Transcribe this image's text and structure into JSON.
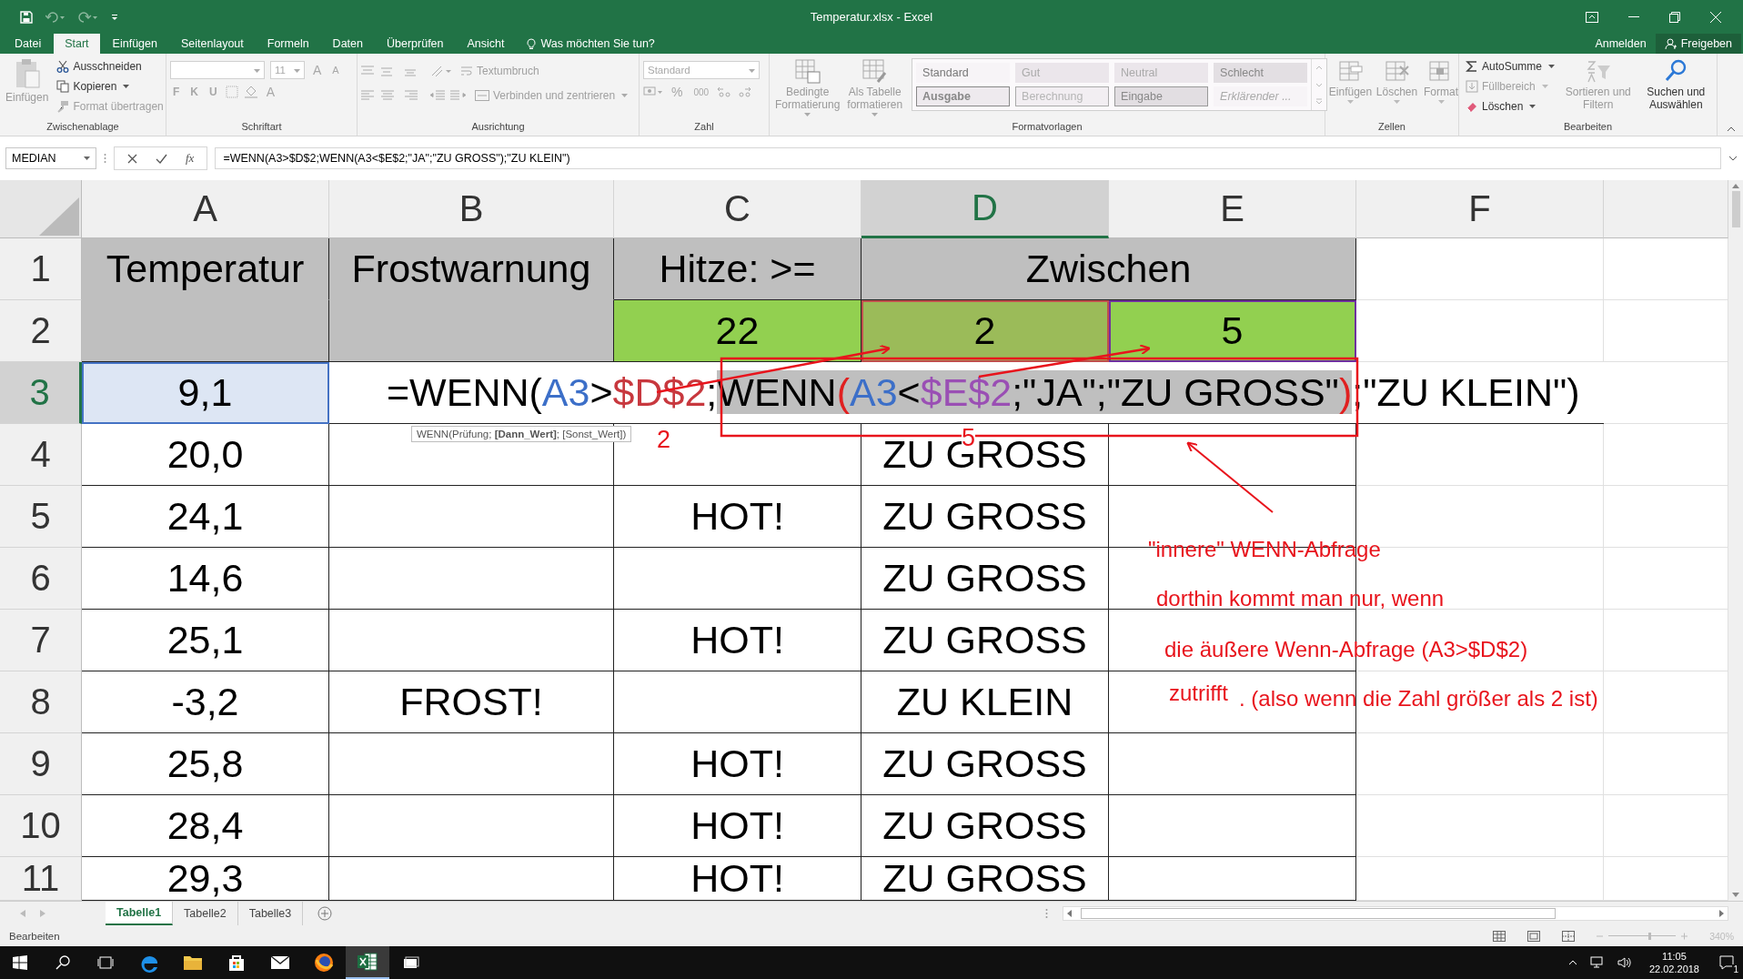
{
  "window": {
    "title": "Temperatur.xlsx - Excel"
  },
  "tabs": [
    {
      "label": "Datei",
      "selected": false
    },
    {
      "label": "Start",
      "selected": true
    },
    {
      "label": "Einfügen",
      "selected": false
    },
    {
      "label": "Seitenlayout",
      "selected": false
    },
    {
      "label": "Formeln",
      "selected": false
    },
    {
      "label": "Daten",
      "selected": false
    },
    {
      "label": "Überprüfen",
      "selected": false
    },
    {
      "label": "Ansicht",
      "selected": false
    }
  ],
  "tell_me": "Was möchten Sie tun?",
  "account": {
    "sign_in": "Anmelden",
    "share": "Freigeben"
  },
  "ribbon": {
    "clipboard": {
      "label": "Zwischenablage",
      "paste": {
        "label": "Einfügen",
        "disabled": true
      },
      "items": [
        {
          "label": "Ausschneiden",
          "disabled": false
        },
        {
          "label": "Kopieren",
          "disabled": false
        },
        {
          "label": "Format übertragen",
          "disabled": true
        }
      ]
    },
    "font": {
      "label": "Schriftart",
      "size": "11",
      "grow": "A",
      "shrink": "A",
      "styles": [
        "F",
        "K",
        "U"
      ],
      "font_color": "A"
    },
    "alignment": {
      "label": "Ausrichtung",
      "wrap": "Textumbruch",
      "merge": "Verbinden und zentrieren"
    },
    "number": {
      "label": "Zahl",
      "format": "Standard",
      "percent": "%",
      "thousands": "000"
    },
    "format_buttons": [
      {
        "label": "Bedingte Formatierung"
      },
      {
        "label": "Als Tabelle formatieren"
      }
    ],
    "styles": {
      "label": "Formatvorlagen",
      "cells": [
        {
          "label": "Standard",
          "kind": "normal"
        },
        {
          "label": "Gut",
          "kind": "good"
        },
        {
          "label": "Neutral",
          "kind": "neutral"
        },
        {
          "label": "Schlecht",
          "kind": "bad"
        },
        {
          "label": "Ausgabe",
          "kind": "output"
        },
        {
          "label": "Berechnung",
          "kind": "calc"
        },
        {
          "label": "Eingabe",
          "kind": "input"
        },
        {
          "label": "Erklärender ...",
          "kind": "explanatory"
        }
      ]
    },
    "cells": {
      "label": "Zellen",
      "items": [
        "Einfügen",
        "Löschen",
        "Format"
      ]
    },
    "editing": {
      "label": "Bearbeiten",
      "items": [
        {
          "label": "AutoSumme",
          "disabled": false
        },
        {
          "label": "Füllbereich",
          "disabled": true
        },
        {
          "label": "Löschen",
          "disabled": false
        }
      ],
      "sort": {
        "label": "Sortieren und Filtern",
        "disabled": true
      },
      "find": {
        "label": "Suchen und Auswählen",
        "disabled": false
      }
    }
  },
  "formula_bar": {
    "name_box": "MEDIAN",
    "fx": "fx",
    "formula": "=WENN(A3>$D$2;WENN(A3<$E$2;\"JA\";\"ZU GROSS\");\"ZU KLEIN\")"
  },
  "sheet": {
    "columns": [
      {
        "label": "A",
        "selected": false
      },
      {
        "label": "B",
        "selected": false
      },
      {
        "label": "C",
        "selected": false
      },
      {
        "label": "D",
        "selected": true
      },
      {
        "label": "E",
        "selected": false
      },
      {
        "label": "F",
        "selected": false
      }
    ],
    "rows": [
      {
        "header": "1",
        "selected": false,
        "cells": [
          {
            "text": "Temperatur",
            "color": "#bfbfbf"
          },
          {
            "text": "Frostwarnung",
            "color": "#bfbfbf"
          },
          {
            "text": "Hitze: >=",
            "color": "#bfbfbf"
          },
          {
            "text": "Zwischen",
            "color": "#bfbfbf",
            "merged": true
          }
        ]
      },
      {
        "header": "2",
        "selected": false,
        "cells": [
          {
            "color": "#bfbfbf"
          },
          {
            "color": "#bfbfbf"
          },
          {
            "text": "22",
            "color": "#92d050"
          },
          {
            "text": "2",
            "color": "#9bbb59",
            "outline": {
              "color": "#c0504d"
            }
          },
          {
            "text": "5",
            "color": "#92d050",
            "outline": {
              "color": "#7030a0"
            }
          }
        ]
      },
      {
        "header": "3",
        "selected": true,
        "kind": "editing",
        "cells": [
          {
            "text": "9,1",
            "color": "#dde6f4",
            "outline": {
              "color": "#4472c4"
            }
          }
        ],
        "editor": {
          "segments": [
            {
              "text": "=WENN(",
              "color": "#000000",
              "highlighted": false
            },
            {
              "text": "A3",
              "color": "#3c6fc8",
              "highlighted": false
            },
            {
              "text": ">",
              "color": "#000000",
              "highlighted": false
            },
            {
              "text": "$D$2",
              "color": "#c8383e",
              "highlighted": false
            },
            {
              "text": ";",
              "color": "#000000",
              "highlighted": false
            },
            {
              "text": "WENN",
              "color": "#000000",
              "highlighted": true
            },
            {
              "text": "(",
              "color": "#e02020",
              "highlighted": true
            },
            {
              "text": "A3",
              "color": "#3c6fc8",
              "highlighted": true
            },
            {
              "text": "<",
              "color": "#000000",
              "highlighted": true
            },
            {
              "text": "$E$2",
              "color": "#9a4fb4",
              "highlighted": true
            },
            {
              "text": ";\"JA\";\"ZU GROSS\"",
              "color": "#000000",
              "highlighted": true
            },
            {
              "text": ")",
              "color": "#e02020",
              "highlighted": true
            },
            {
              "text": ";\"ZU KLEIN\")",
              "color": "#000000",
              "highlighted": false
            }
          ],
          "tooltip": "WENN(Prüfung; **[Dann_Wert]**; [Sonst_Wert])"
        }
      },
      {
        "header": "4",
        "selected": false,
        "cells": [
          {
            "text": "20,0"
          },
          {},
          {},
          {
            "text": "ZU GROSS"
          }
        ]
      },
      {
        "header": "5",
        "selected": false,
        "cells": [
          {
            "text": "24,1"
          },
          {},
          {
            "text": "HOT!"
          },
          {
            "text": "ZU GROSS"
          }
        ]
      },
      {
        "header": "6",
        "selected": false,
        "cells": [
          {
            "text": "14,6"
          },
          {},
          {},
          {
            "text": "ZU GROSS"
          }
        ]
      },
      {
        "header": "7",
        "selected": false,
        "cells": [
          {
            "text": "25,1"
          },
          {},
          {
            "text": "HOT!"
          },
          {
            "text": "ZU GROSS"
          }
        ]
      },
      {
        "header": "8",
        "selected": false,
        "cells": [
          {
            "text": "-3,2"
          },
          {
            "text": "FROST!"
          },
          {},
          {
            "text": "ZU KLEIN"
          }
        ]
      },
      {
        "header": "9",
        "selected": false,
        "cells": [
          {
            "text": "25,8"
          },
          {},
          {
            "text": "HOT!"
          },
          {
            "text": "ZU GROSS"
          }
        ]
      },
      {
        "header": "10",
        "selected": false,
        "cells": [
          {
            "text": "28,4"
          },
          {},
          {
            "text": "HOT!"
          },
          {
            "text": "ZU GROSS"
          }
        ]
      },
      {
        "header": "11",
        "selected": false,
        "cells": [
          {
            "text": "29,3"
          },
          {},
          {
            "text": "HOT!"
          },
          {
            "text": "ZU GROSS"
          }
        ]
      }
    ]
  },
  "annotations": {
    "numbers": [
      "2",
      "5"
    ],
    "notes": [
      "\"innere\" WENN-Abfrage",
      "dorthin kommt man nur, wenn",
      "die äußere Wenn-Abfrage (A3>$D$2)",
      "zutrifft",
      ". (also wenn die Zahl größer als 2 ist)"
    ]
  },
  "sheet_tabs": [
    {
      "label": "Tabelle1",
      "selected": true
    },
    {
      "label": "Tabelle2",
      "selected": false
    },
    {
      "label": "Tabelle3",
      "selected": false
    }
  ],
  "status_bar": {
    "mode": "Bearbeiten",
    "zoom_slider": {
      "level": 0.6
    },
    "zoom": "340%"
  },
  "taskbar": {
    "apps": [
      {
        "active": false
      },
      {
        "active": false
      },
      {
        "active": false
      },
      {
        "active": false
      },
      {
        "active": false
      },
      {
        "active": true
      },
      {
        "active": false
      }
    ],
    "time": "11:05",
    "date": "22.02.2018",
    "notifications": "1"
  }
}
